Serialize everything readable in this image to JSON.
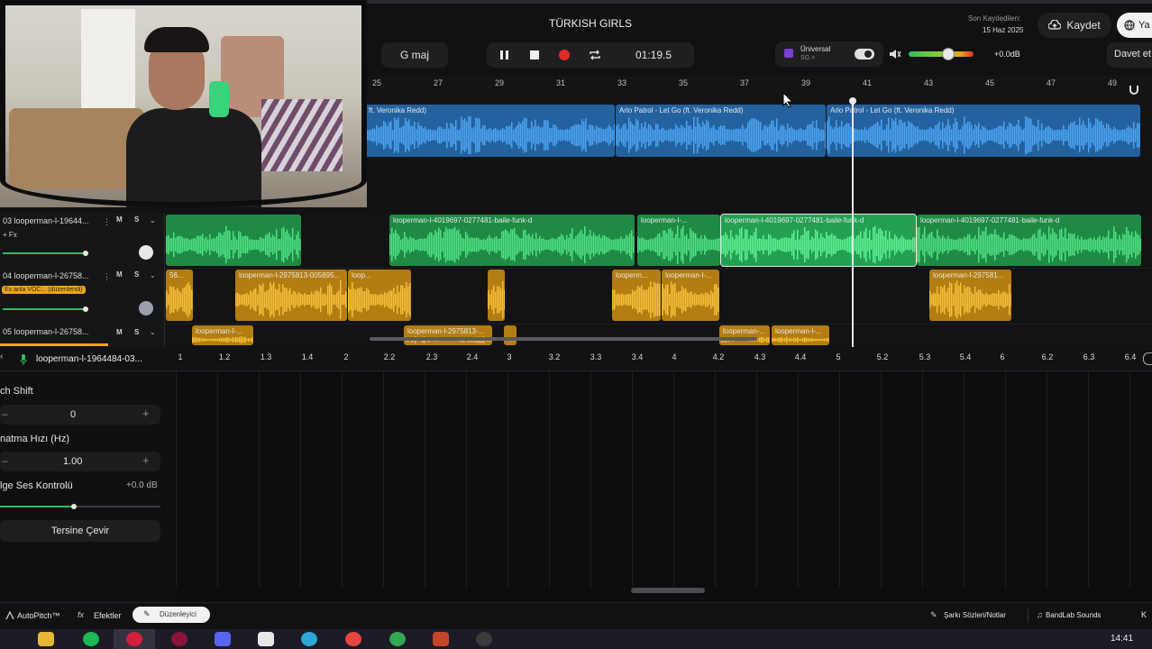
{
  "project": {
    "title": "TÜRKISH GIRLS"
  },
  "save": {
    "last_saved_label": "Son Kaydedilen:",
    "last_saved_date": "15 Haz 2025",
    "save_button": "Kaydet",
    "help_partial": "Ya",
    "invite_partial": "Davet et"
  },
  "transport": {
    "key": "G maj",
    "time": "01:19.5"
  },
  "preset": {
    "name": "Üniversal",
    "sub": "SG >"
  },
  "master": {
    "volume_db": "+0.0dB",
    "volume_level": 0.6
  },
  "ruler": {
    "ticks": [
      "25",
      "27",
      "29",
      "31",
      "33",
      "35",
      "37",
      "39",
      "41",
      "43",
      "45",
      "47",
      "49"
    ]
  },
  "tracks": {
    "top_clips": [
      "ft. Veronika Redd)",
      "Arlo Patrol - Let Go (ft. Veronika Redd)",
      "Arlo Patrol - Let Go (ft. Veronika Redd)"
    ],
    "track3": {
      "name": "03  looperman-l-19644...",
      "fx": "+ Fx",
      "m": "M",
      "s": "S",
      "clips": [
        "looperman-l-4019697-0277481-baile-funk-d",
        "looperman-l-...",
        "looperman-l-4019697-0277481-baile-funk-d",
        "looperman-l-4019697-0277481-baile-funk-d"
      ]
    },
    "track4": {
      "name": "04  looperman-l-26758...",
      "tag": "Ex anla VOC... (düzenlendi)",
      "m": "M",
      "s": "S",
      "clips": [
        "56...",
        "looperman-l-2975813-005895...",
        "loop...",
        "looperm...",
        "looperman-l-...",
        "looperman-l-297581..."
      ]
    },
    "track5": {
      "name": "05  looperman-l-26758...",
      "m": "M",
      "s": "S",
      "clips": [
        "looperman-l-...",
        "looperman-l-2975813-...",
        "looperman-...",
        "looperman-l-..."
      ]
    }
  },
  "editor": {
    "clip_name": "looperman-l-1964484-03...",
    "ticks": [
      "1",
      "1.2",
      "1.3",
      "1.4",
      "2",
      "2.2",
      "2.3",
      "2.4",
      "3",
      "3.2",
      "3.3",
      "3.4",
      "4",
      "4.2",
      "4.3",
      "4.4",
      "5",
      "5.2",
      "5.3",
      "5.4",
      "6",
      "6.2",
      "6.3",
      "6.4"
    ],
    "pitch_label": "ch Shift",
    "pitch_value": "0",
    "rate_label": "natma Hızı (Hz)",
    "rate_value": "1.00",
    "gain_label": "lge Ses Kontrolü",
    "gain_value": "+0.0 dB",
    "reverse_button": "Tersine Çevir"
  },
  "status": {
    "autopitch": "AutoPitch™",
    "effects": "Efektler",
    "editor": "Düzenleyici",
    "lyrics": "Şarkı Sözleri/Notlar",
    "sounds": "BandLab Sounds",
    "more": "K"
  },
  "taskbar": {
    "clock": "14:41"
  },
  "colors": {
    "blue": "#2f86d8",
    "green": "#2fbf5a",
    "orange": "#e8a51b",
    "record": "#e12b2b"
  }
}
